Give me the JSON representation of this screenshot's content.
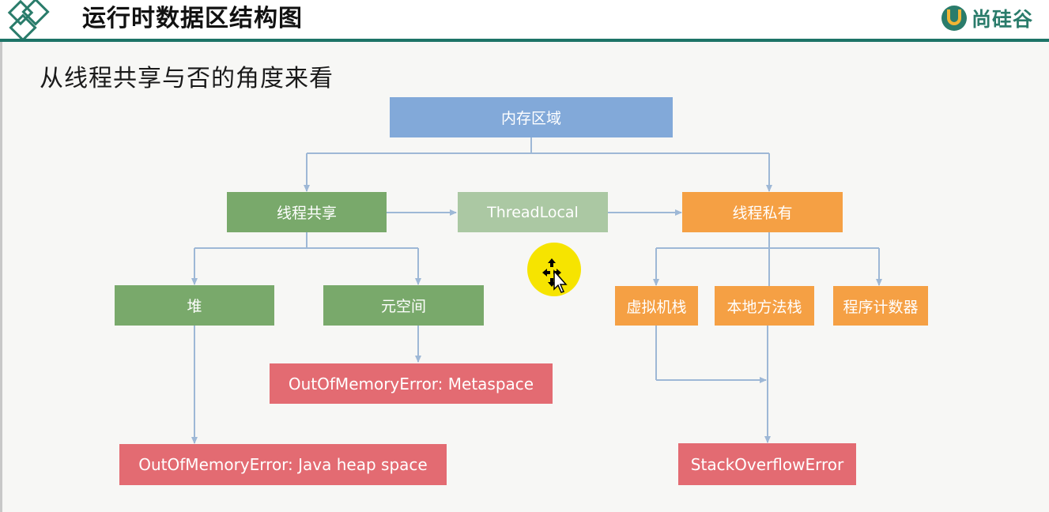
{
  "header": {
    "title": "运行时数据区结构图",
    "brand": "尚硅谷"
  },
  "subtitle": "从线程共享与否的角度来看",
  "nodes": {
    "memory_area": "内存区域",
    "thread_shared": "线程共享",
    "thread_local": "ThreadLocal",
    "thread_private": "线程私有",
    "heap": "堆",
    "metaspace": "元空间",
    "vm_stack": "虚拟机栈",
    "native_stack": "本地方法栈",
    "pc_register": "程序计数器",
    "oom_metaspace": "OutOfMemoryError: Metaspace",
    "oom_heap": "OutOfMemoryError: Java heap space",
    "stack_overflow": "StackOverflowError"
  },
  "colors": {
    "header_rule": "#1d7467",
    "root_node": "#82a9d9",
    "shared_node": "#79a96b",
    "threadlocal_node": "#abc8a3",
    "private_node": "#f5a044",
    "error_node": "#e36b72",
    "connector": "#9eb8d6",
    "cursor_highlight": "#f6e400"
  },
  "icons": {
    "logo": "diamond-logo-icon",
    "brand": "brand-u-icon",
    "cursor": "move-cursor-icon"
  }
}
